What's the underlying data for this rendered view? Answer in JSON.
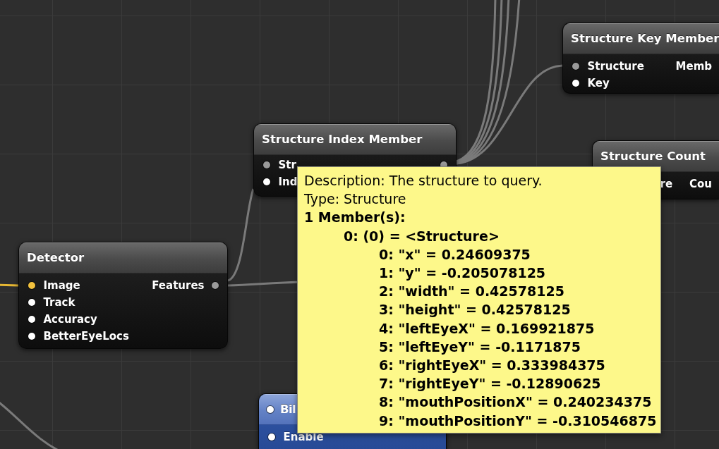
{
  "canvas": {
    "nodes": [
      {
        "kind": "patch",
        "title": "Structure Key Member",
        "inputs": [
          {
            "label": "Structure",
            "color": "#9a9a9a"
          },
          {
            "label": "Key",
            "color": "#ffffff"
          }
        ],
        "outputs": [
          {
            "label": "Memb"
          }
        ]
      },
      {
        "kind": "patch",
        "title": "Structure Index Member",
        "inputs": [
          {
            "label": "Str",
            "color": "#9a9a9a"
          },
          {
            "label": "Ind",
            "color": "#ffffff"
          }
        ],
        "outputs": [
          {
            "color": "#9a9a9a"
          }
        ]
      },
      {
        "kind": "patch",
        "title": "Structure Count",
        "inputs": [
          {
            "label": "re"
          }
        ],
        "outputs": [
          {
            "label": "Cou"
          }
        ]
      },
      {
        "kind": "patch",
        "title": "Detector",
        "inputs": [
          {
            "label": "Image",
            "color": "#f3c23e"
          },
          {
            "label": "Track",
            "color": "#ffffff"
          },
          {
            "label": "Accuracy",
            "color": "#ffffff"
          },
          {
            "label": "BetterEyeLocs",
            "color": "#ffffff"
          }
        ],
        "outputs": [
          {
            "label": "Features",
            "color": "#9a9a9a"
          }
        ]
      },
      {
        "kind": "consumer",
        "title": "Bil",
        "inputs": [
          {
            "label": "Enable",
            "color": "#ffffff"
          }
        ]
      }
    ]
  },
  "tooltip": {
    "lines": [
      "Description: The structure to query.",
      "Type: Structure"
    ],
    "members": {
      "heading": "1 Member(s):",
      "children": [
        {
          "text": "0: (0) = <Structure>",
          "children": [
            {
              "text": "0: \"x\" = 0.24609375"
            },
            {
              "text": "1: \"y\" = -0.205078125"
            },
            {
              "text": "2: \"width\" = 0.42578125"
            },
            {
              "text": "3: \"height\" = 0.42578125"
            },
            {
              "text": "4: \"leftEyeX\" = 0.169921875"
            },
            {
              "text": "5: \"leftEyeY\" = -0.1171875"
            },
            {
              "text": "6: \"rightEyeX\" = 0.333984375"
            },
            {
              "text": "7: \"rightEyeY\" = -0.12890625"
            },
            {
              "text": "8: \"mouthPositionX\" = 0.240234375"
            },
            {
              "text": "9: \"mouthPositionY\" = -0.310546875"
            }
          ]
        }
      ]
    }
  }
}
